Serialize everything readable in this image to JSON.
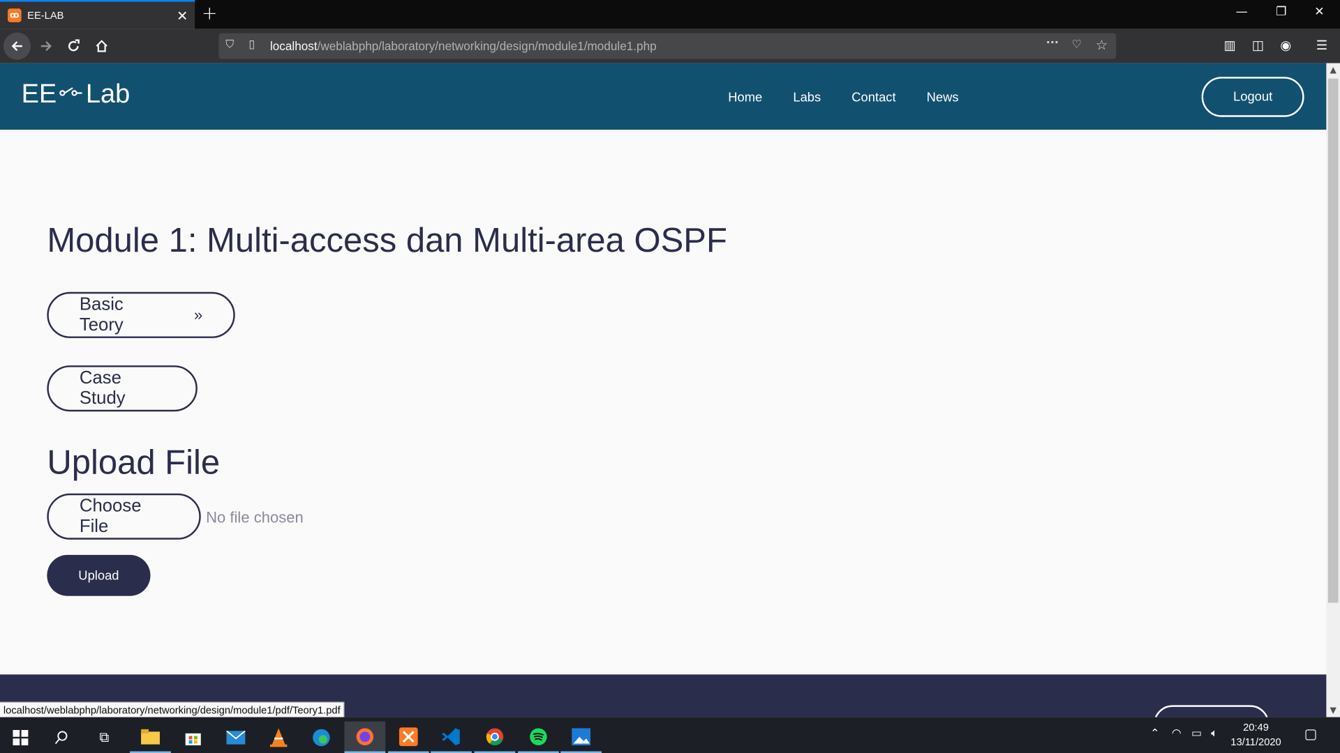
{
  "browser": {
    "tab_title": "EE-LAB",
    "url_host": "localhost",
    "url_path": "/weblabphp/laboratory/networking/design/module1/module1.php",
    "status_url": "localhost/weblabphp/laboratory/networking/design/module1/pdf/Teory1.pdf"
  },
  "site": {
    "logo_left": "EE",
    "logo_right": "Lab",
    "nav": [
      "Home",
      "Labs",
      "Contact",
      "News"
    ],
    "logout_label": "Logout"
  },
  "main": {
    "title": "Module 1: Multi-access dan Multi-area OSPF",
    "basic_teory_label": "Basic Teory",
    "basic_teory_arrow": "»",
    "case_study_label": "Case Study",
    "upload_heading": "Upload File",
    "choose_file_label": "Choose File",
    "no_file_text": "No file chosen",
    "upload_label": "Upload"
  },
  "taskbar": {
    "time": "20:49",
    "date": "13/11/2020"
  },
  "colors": {
    "header_bg": "#12506f",
    "primary_dark": "#2b2d4c",
    "page_bg": "#fafafa"
  }
}
